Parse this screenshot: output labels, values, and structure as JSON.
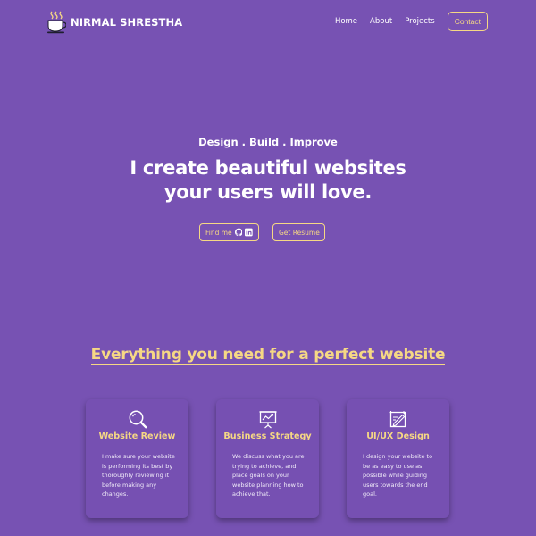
{
  "header": {
    "brand_name": "NIRMAL SHRESTHA",
    "nav": [
      "Home",
      "About",
      "Projects"
    ],
    "contact_label": "Contact"
  },
  "hero": {
    "subtitle": "Design . Build . Improve",
    "title_line1": "I create beautiful websites",
    "title_line2": "your users will love.",
    "find_me_label": "Find me",
    "resume_label": "Get Resume"
  },
  "services": {
    "heading": "Everything you need for a perfect website",
    "cards": [
      {
        "icon": "magnifier-icon",
        "title": "Website Review",
        "text": "I make sure your website is performing its best by thoroughly reviewing it before making any changes."
      },
      {
        "icon": "presentation-chart-icon",
        "title": "Business Strategy",
        "text": "We discuss what you are trying to achieve, and place goals on your website planning how to achieve that."
      },
      {
        "icon": "design-tool-icon",
        "title": "UI/UX Design",
        "text": "I design your website to be as easy to use as possible while guiding users towards the end goal."
      }
    ]
  },
  "colors": {
    "background": "#7752b3",
    "accent": "#f6d884",
    "text": "#ffffff"
  }
}
